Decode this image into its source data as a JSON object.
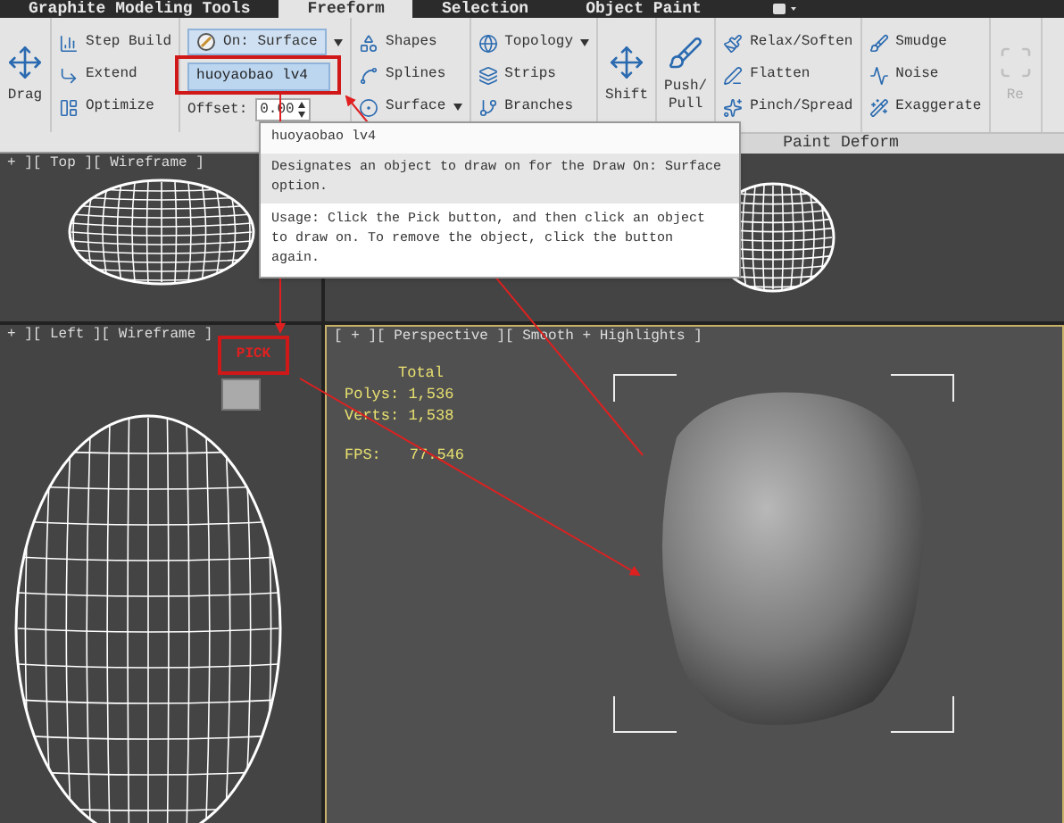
{
  "tabs": [
    {
      "label": "Graphite Modeling Tools",
      "selected": false
    },
    {
      "label": "Freeform",
      "selected": true
    },
    {
      "label": "Selection",
      "selected": false
    },
    {
      "label": "Object Paint",
      "selected": false
    }
  ],
  "ribbon": {
    "columns": [
      {
        "kind": "large",
        "items": [
          {
            "label": "Drag",
            "disabled": false
          }
        ]
      },
      {
        "kind": "stack",
        "items": [
          {
            "label": "Step Build"
          },
          {
            "label": "Extend"
          },
          {
            "label": "Optimize"
          }
        ]
      },
      {
        "kind": "draw_on",
        "surface_button": "On: Surface",
        "pick_field": "huoyaobao lv4",
        "offset_label": "Offset:",
        "offset_value": "0.00"
      },
      {
        "kind": "stack",
        "items": [
          {
            "label": "Shapes"
          },
          {
            "label": "Splines"
          },
          {
            "label": "Surface",
            "dropdown": true
          }
        ]
      },
      {
        "kind": "stack",
        "items": [
          {
            "label": "Topology",
            "dropdown": true
          },
          {
            "label": "Strips"
          },
          {
            "label": "Branches"
          }
        ]
      },
      {
        "kind": "large",
        "items": [
          {
            "label": "Shift",
            "disabled": false
          }
        ]
      },
      {
        "kind": "large",
        "items": [
          {
            "label": "Push/\nPull",
            "disabled": false
          }
        ]
      },
      {
        "kind": "stack",
        "items": [
          {
            "label": "Relax/Soften"
          },
          {
            "label": "Flatten"
          },
          {
            "label": "Pinch/Spread"
          }
        ]
      },
      {
        "kind": "stack",
        "items": [
          {
            "label": "Smudge"
          },
          {
            "label": "Noise"
          },
          {
            "label": "Exaggerate"
          }
        ]
      },
      {
        "kind": "large",
        "items": [
          {
            "label": "Re",
            "disabled": true
          }
        ]
      }
    ],
    "panel_label": "Paint Deform"
  },
  "tooltip": {
    "title": "huoyaobao lv4",
    "description": "Designates an object to draw on for the Draw On: Surface option.",
    "usage": "Usage: Click the Pick button, and then click an object to draw on. To remove the object, click the button again."
  },
  "viewports": {
    "top": {
      "label": "+ ][ Top ][ Wireframe ]"
    },
    "left": {
      "label": "+ ][ Left ][ Wireframe ]"
    },
    "perspective": {
      "label": "[ + ][ Perspective ][ Smooth + Highlights ]",
      "stats_heading": "Total",
      "polys": "Polys: 1,536",
      "verts": "Verts: 1,538",
      "fps_label": "FPS:",
      "fps_value": "77.546"
    }
  },
  "annotations": {
    "pick_label": "PICK"
  }
}
